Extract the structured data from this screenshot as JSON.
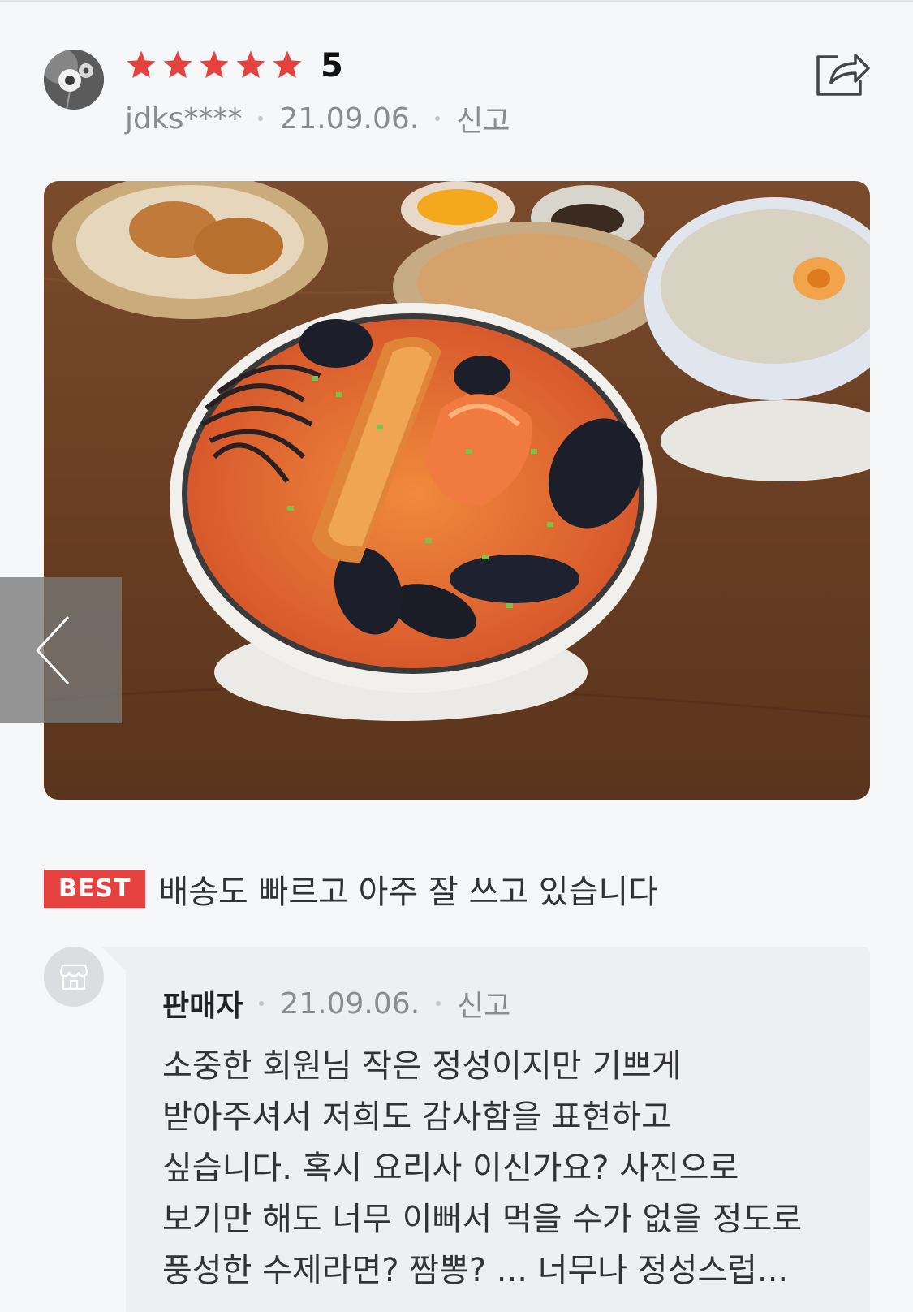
{
  "review": {
    "rating": "5",
    "star_count": 5,
    "star_color": "#e5413e",
    "user_id": "jdks****",
    "date": "21.09.06.",
    "report_label": "신고",
    "best_badge": "BEST",
    "text": "배송도 빠르고 아주 잘 쓰고 있습니다"
  },
  "icons": {
    "share": "share-icon",
    "prev": "chevron-left-icon",
    "seller": "store-icon"
  },
  "seller_reply": {
    "name": "판매자",
    "date": "21.09.06.",
    "report_label": "신고",
    "lines": [
      "소중한 회원님 작은 정성이지만 기쁘게",
      "받아주셔서 저희도 감사함을 표현하고",
      "싶습니다. 혹시 요리사 이신가요? 사진으로",
      "보기만 해도 너무 이뻐서 먹을 수가 없을 정도로",
      "풍성한 수제라면? 짬뽕? ... 너무나 정성스럽..."
    ]
  }
}
